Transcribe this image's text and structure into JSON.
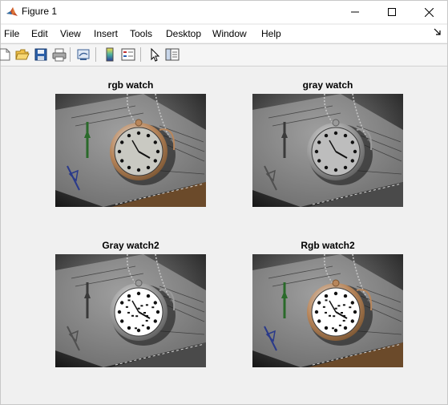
{
  "window": {
    "title": "Figure 1",
    "icon": "matlab-logo-icon",
    "controls": [
      "minimize-icon",
      "maximize-icon",
      "close-icon"
    ]
  },
  "menu": {
    "items": [
      "File",
      "Edit",
      "View",
      "Insert",
      "Tools",
      "Desktop",
      "Window",
      "Help"
    ],
    "overflow_icon": "dock-arrow-icon"
  },
  "toolbar": {
    "buttons": [
      "new-figure-icon",
      "open-file-icon",
      "save-icon",
      "print-icon",
      "link-plot-icon",
      "colorbar-icon",
      "legend-icon",
      "pointer-icon",
      "property-editor-icon"
    ]
  },
  "axes": [
    {
      "title": "rgb watch",
      "variant": "rgb"
    },
    {
      "title": "gray watch",
      "variant": "gray"
    },
    {
      "title": "Gray watch2",
      "variant": "gray-binarized-face"
    },
    {
      "title": "Rgb watch2",
      "variant": "rgb-binarized-face"
    }
  ],
  "colors": {
    "figure_bg": "#f0f0f0",
    "brass": "#b8865b",
    "wood": "#6b4a2a"
  }
}
